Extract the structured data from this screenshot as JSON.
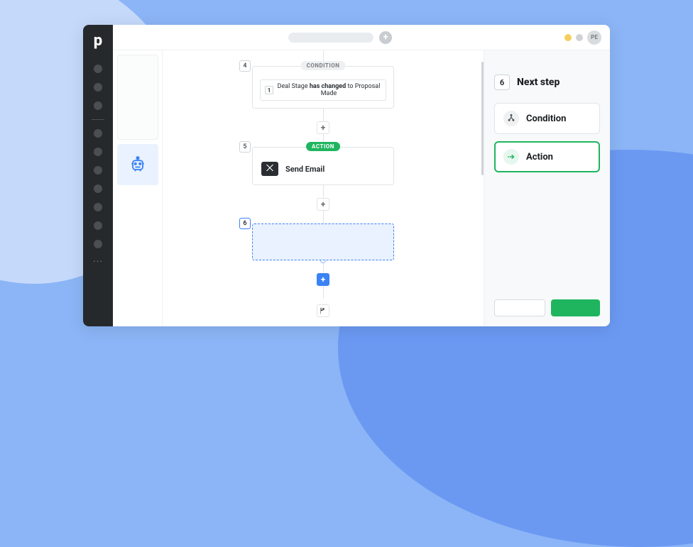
{
  "brand_letter": "p",
  "topbar": {
    "plus_glyph": "+",
    "avatar_initials": "PE"
  },
  "flow": {
    "condition": {
      "step_num": "4",
      "tag": "CONDITION",
      "inner_num": "1",
      "before": "Deal Stage ",
      "bold": "has changed",
      "after": " to Proposal Made"
    },
    "action": {
      "step_num": "5",
      "tag": "ACTION",
      "label": "Send Email"
    },
    "placeholder": {
      "step_num": "6"
    },
    "add_glyph": "+"
  },
  "rightpanel": {
    "step_num": "6",
    "title": "Next step",
    "options": [
      {
        "key": "condition",
        "label": "Condition",
        "selected": false
      },
      {
        "key": "action",
        "label": "Action",
        "selected": true
      }
    ]
  }
}
